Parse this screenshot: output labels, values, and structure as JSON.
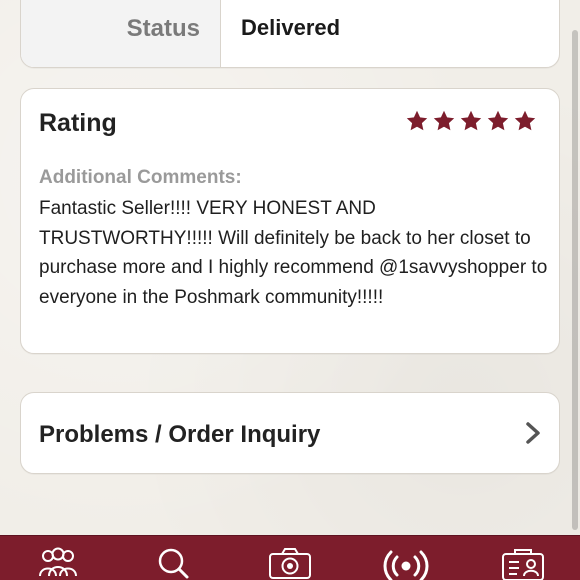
{
  "status": {
    "label": "Status",
    "value": "Delivered"
  },
  "rating": {
    "title": "Rating",
    "stars_filled": 5,
    "stars_total": 5,
    "star_color": "#7d1d2c",
    "comments_label": "Additional Comments:",
    "comments_text": "Fantastic Seller!!!! VERY HONEST AND TRUSTWORTHY!!!!! Will definitely be back to her closet to purchase more and I highly recommend @1savvyshopper to everyone in the Poshmark community!!!!!"
  },
  "problems": {
    "label": "Problems / Order Inquiry",
    "chevron_icon": "chevron-right-icon"
  },
  "tabbar": {
    "background": "#7d1d2c",
    "items": [
      {
        "icon": "people-icon"
      },
      {
        "icon": "search-icon"
      },
      {
        "icon": "camera-icon"
      },
      {
        "icon": "broadcast-icon"
      },
      {
        "icon": "profile-card-icon"
      }
    ]
  }
}
